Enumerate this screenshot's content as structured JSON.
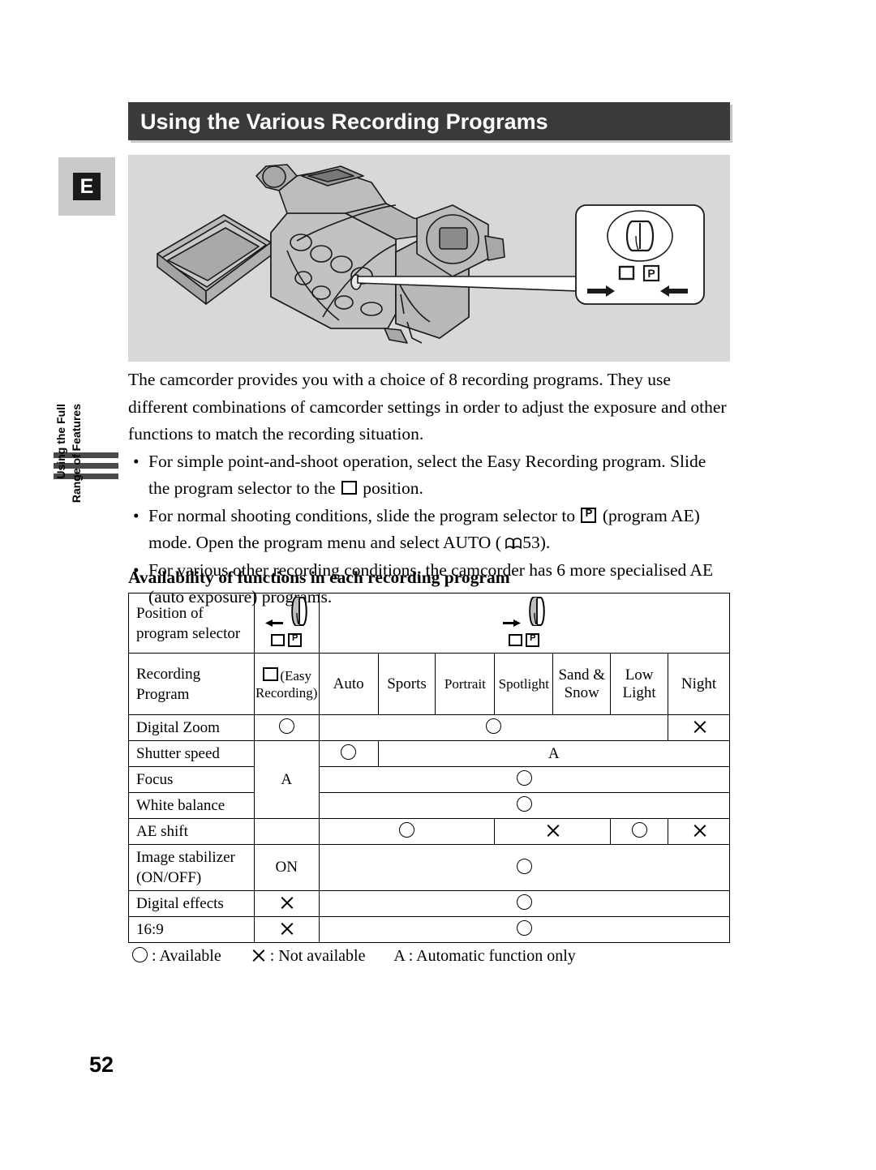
{
  "page": {
    "title": "Using the Various Recording Programs",
    "number": "52",
    "side_tab_letter": "E",
    "running_head_lines": [
      "Using the Full",
      "Range of Features"
    ]
  },
  "illustration": {
    "caption_icons": {
      "easy_box": "□",
      "program_ae": "P"
    },
    "callout": {
      "square_label": "□",
      "p_label": "P",
      "left_arrow": "←",
      "right_arrow": "→"
    }
  },
  "intro": {
    "paragraph": "The camcorder provides you with a choice of 8 recording programs. They use different combinations of camcorder settings in order to adjust the exposure and other functions to match the recording situation.",
    "bullets": [
      {
        "pre": "For simple point-and-shoot operation, select the Easy Recording program. Slide the program selector to the",
        "icon": "square-icon",
        "post": "position."
      },
      {
        "pre": "For normal shooting conditions, slide the program selector to",
        "icon": "program-ae-icon",
        "mid": "(program AE) mode. Open the program menu and select AUTO (",
        "ref_icon": "book-icon",
        "ref_page": "53",
        "post": ")."
      },
      {
        "pre": "For various other recording conditions, the camcorder has 6 more specialised AE (auto exposure) programs."
      }
    ]
  },
  "table": {
    "heading": "Availability of functions in each recording program",
    "row_position_label": [
      "Position of",
      "program selector"
    ],
    "row_program_label": [
      "Recording",
      "Program"
    ],
    "easy_column": {
      "icon": "□",
      "line1": "(Easy",
      "line2": "Recording)"
    },
    "programs": [
      "Auto",
      "Sports",
      "Portrait",
      "Spotlight",
      "Sand & Snow",
      "Low Light",
      "Night"
    ],
    "program_multiline": {
      "sand_snow": [
        "Sand &",
        "Snow"
      ],
      "low_light": [
        "Low",
        "Light"
      ]
    },
    "rows": [
      {
        "label": "Digital Zoom",
        "easy": "O",
        "cells": [
          {
            "value": "O",
            "span": 6
          },
          {
            "value": "X",
            "span": 1
          }
        ]
      },
      {
        "label": "Shutter speed",
        "easy": "A",
        "easy_rowspan": 3,
        "cells": [
          {
            "value": "O",
            "span": 1
          },
          {
            "value": "A",
            "span": 6
          }
        ]
      },
      {
        "label": "Focus",
        "cells": [
          {
            "value": "O",
            "span": 7
          }
        ]
      },
      {
        "label": "White balance",
        "cells": [
          {
            "value": "O",
            "span": 7
          }
        ]
      },
      {
        "label": "AE shift",
        "easy": "",
        "cells": [
          {
            "value": "O",
            "span": 3
          },
          {
            "value": "X",
            "span": 2
          },
          {
            "value": "O",
            "span": 1
          },
          {
            "value": "X",
            "span": 1
          }
        ]
      },
      {
        "label": "Image stabilizer (ON/OFF)",
        "label_lines": [
          "Image stabilizer",
          "(ON/OFF)"
        ],
        "easy": "ON",
        "cells": [
          {
            "value": "O",
            "span": 7
          }
        ]
      },
      {
        "label": "Digital effects",
        "easy": "X",
        "cells": [
          {
            "value": "O",
            "span": 7
          }
        ]
      },
      {
        "label": "16:9",
        "easy": "X",
        "cells": [
          {
            "value": "O",
            "span": 7
          }
        ]
      }
    ]
  },
  "legend": {
    "available": ": Available",
    "not_available": ": Not available",
    "automatic": "A : Automatic function only"
  }
}
